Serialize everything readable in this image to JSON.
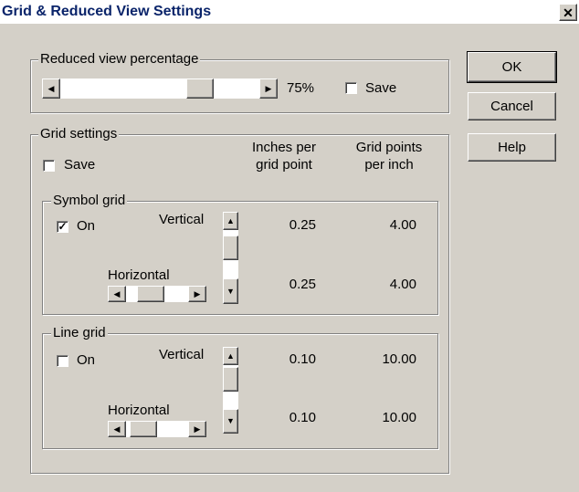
{
  "window": {
    "title": "Grid & Reduced View Settings"
  },
  "buttons": {
    "ok": "OK",
    "cancel": "Cancel",
    "help": "Help"
  },
  "reduced_view": {
    "group_label": "Reduced view percentage",
    "value_text": "75%",
    "save_label": "Save",
    "save_checked": false
  },
  "grid_settings": {
    "group_label": "Grid settings",
    "save_label": "Save",
    "save_checked": false,
    "col_inches": [
      "Inches per",
      "grid point"
    ],
    "col_points": [
      "Grid points",
      "per inch"
    ]
  },
  "symbol_grid": {
    "group_label": "Symbol grid",
    "on_label": "On",
    "on_checked": true,
    "vertical_label": "Vertical",
    "horizontal_label": "Horizontal",
    "vertical_inches": "0.25",
    "vertical_points": "4.00",
    "horizontal_inches": "0.25",
    "horizontal_points": "4.00"
  },
  "line_grid": {
    "group_label": "Line grid",
    "on_label": "On",
    "on_checked": false,
    "vertical_label": "Vertical",
    "horizontal_label": "Horizontal",
    "vertical_inches": "0.10",
    "vertical_points": "10.00",
    "horizontal_inches": "0.10",
    "horizontal_points": "10.00"
  },
  "icons": {
    "close": "close-icon",
    "left_arrow": "scroll-left-icon",
    "right_arrow": "scroll-right-icon",
    "up_arrow": "scroll-up-icon",
    "down_arrow": "scroll-down-icon",
    "check": "checkmark-icon"
  }
}
